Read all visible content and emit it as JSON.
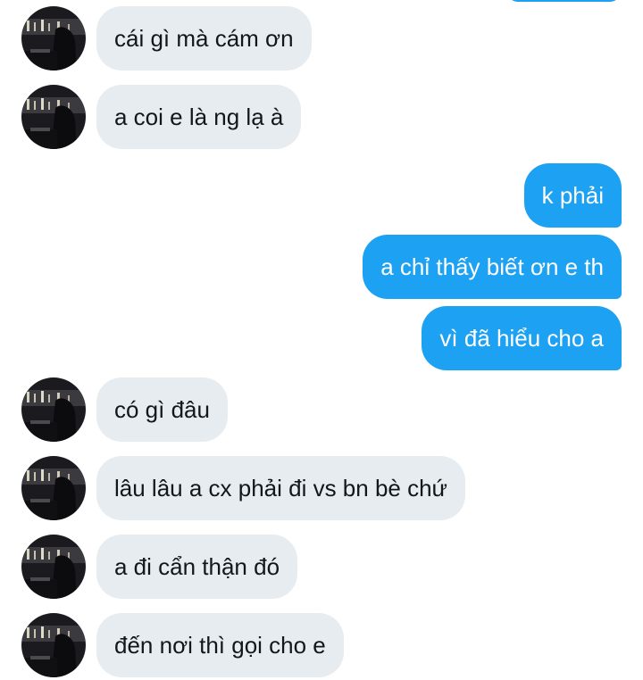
{
  "conversation": {
    "messages": [
      {
        "side": "in",
        "text": "cái gì mà cám ơn"
      },
      {
        "side": "in",
        "text": "a coi e là ng lạ à"
      },
      {
        "side": "out",
        "text": "k phải"
      },
      {
        "side": "out",
        "text": "a chỉ thấy biết ơn e th"
      },
      {
        "side": "out",
        "text": "vì đã hiểu cho a"
      },
      {
        "side": "in",
        "text": "có gì đâu"
      },
      {
        "side": "in",
        "text": "lâu lâu a cx phải đi vs bn bè chứ"
      },
      {
        "side": "in",
        "text": "a đi cẩn thận đó"
      },
      {
        "side": "in",
        "text": "đến nơi thì gọi cho e"
      }
    ]
  },
  "colors": {
    "incoming_bubble": "#e6ecf0",
    "outgoing_bubble": "#1da1f2",
    "incoming_text": "#14171a",
    "outgoing_text": "#ffffff"
  },
  "icons": {
    "avatar": "contact-avatar-photo"
  }
}
